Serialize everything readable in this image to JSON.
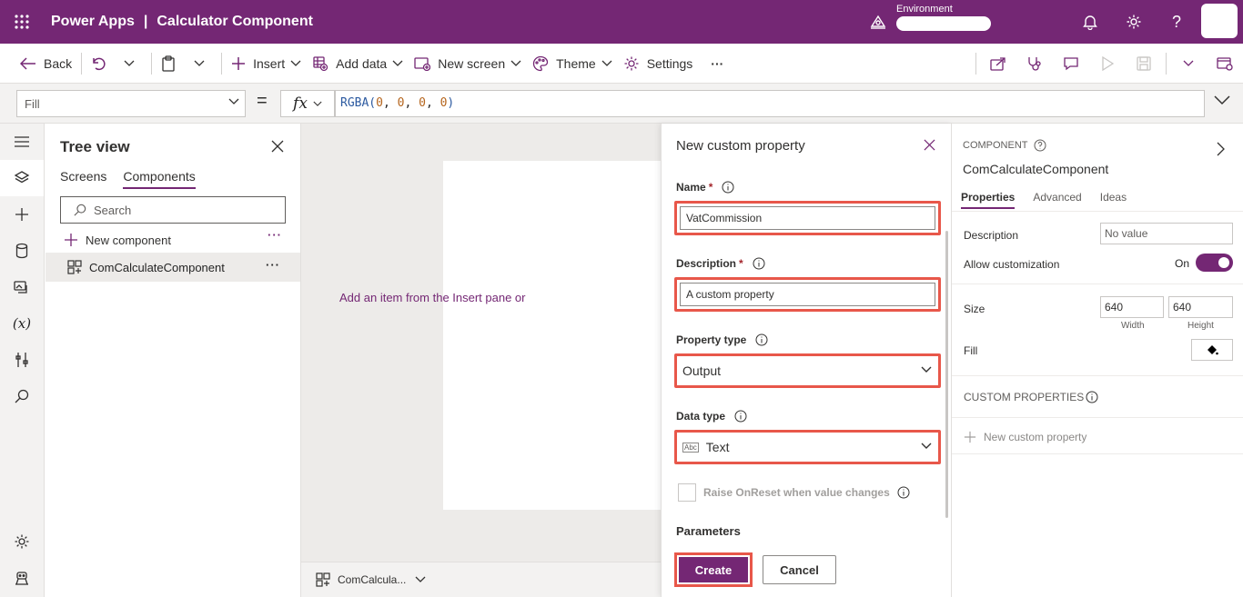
{
  "topbar": {
    "app_name": "Power Apps",
    "separator": "|",
    "doc_title": "Calculator Component",
    "environment_label": "Environment"
  },
  "commandbar": {
    "back": "Back",
    "insert": "Insert",
    "add_data": "Add data",
    "new_screen": "New screen",
    "theme": "Theme",
    "settings": "Settings",
    "more": "···"
  },
  "formulabar": {
    "property": "Fill",
    "equals": "=",
    "fx": "fx",
    "formula_fn": "RGBA(",
    "formula_args": [
      "0",
      "0",
      "0",
      "0"
    ],
    "formula_close": ")"
  },
  "tree": {
    "title": "Tree view",
    "tabs": [
      "Screens",
      "Components"
    ],
    "active_tab": "Components",
    "search_placeholder": "Search",
    "new_component": "New component",
    "new_component_more": "···",
    "items": [
      {
        "label": "ComCalculateComponent",
        "more": "···"
      }
    ]
  },
  "canvas": {
    "hint": "Add an item from the Insert pane or",
    "footer_label": "ComCalcula..."
  },
  "custom_property_panel": {
    "title": "New custom property",
    "name_label": "Name",
    "name_value": "VatCommission",
    "description_label": "Description",
    "description_value": "A custom property",
    "required_mark": "*",
    "property_type_label": "Property type",
    "property_type_value": "Output",
    "data_type_label": "Data type",
    "data_type_icon_text": "Abc",
    "data_type_value": "Text",
    "raise_onreset_label": "Raise OnReset when value changes",
    "parameters_label": "Parameters",
    "create_button": "Create",
    "cancel_button": "Cancel"
  },
  "properties_panel": {
    "kind": "COMPONENT",
    "name": "ComCalculateComponent",
    "tabs": [
      "Properties",
      "Advanced",
      "Ideas"
    ],
    "active_tab": "Properties",
    "description_label": "Description",
    "description_placeholder": "No value",
    "allow_customization_label": "Allow customization",
    "allow_customization_state": "On",
    "size_label": "Size",
    "width_value": "640",
    "height_value": "640",
    "width_caption": "Width",
    "height_caption": "Height",
    "fill_label": "Fill",
    "custom_properties_title": "CUSTOM PROPERTIES",
    "new_custom_property": "New custom property"
  },
  "colors": {
    "brand": "#742774",
    "highlight": "#e8574a"
  },
  "icons": [
    "waffle-icon",
    "environment-icon",
    "bell-icon",
    "gear-icon",
    "help-icon",
    "back-arrow-icon",
    "undo-icon",
    "paste-icon",
    "plus-icon",
    "database-icon",
    "new-screen-icon",
    "palette-icon",
    "settings-icon",
    "share-icon",
    "stethoscope-icon",
    "comment-icon",
    "play-icon",
    "save-icon",
    "publish-icon",
    "hamburger-icon",
    "layers-icon",
    "variables-icon",
    "search-icon",
    "close-icon",
    "info-icon",
    "chevron-down-icon"
  ]
}
